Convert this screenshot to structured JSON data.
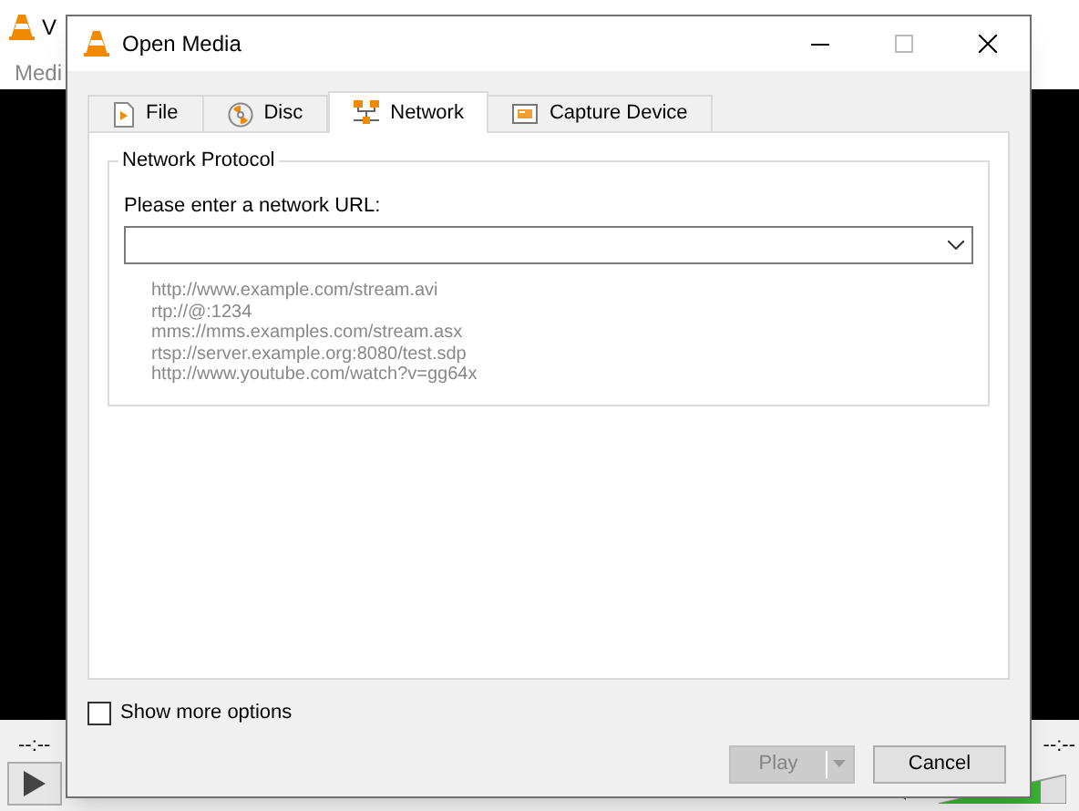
{
  "main_window": {
    "title": "V",
    "menu": [
      "Medi"
    ],
    "elapsed_time": "--:--",
    "total_time": "--:--",
    "volume": {
      "level": 0.8
    }
  },
  "dialog": {
    "title": "Open Media",
    "tabs": [
      {
        "label": "File",
        "kind": "file",
        "selected": false
      },
      {
        "label": "Disc",
        "kind": "disc",
        "selected": false
      },
      {
        "label": "Network",
        "kind": "network",
        "selected": true
      },
      {
        "label": "Capture Device",
        "kind": "capture",
        "selected": false
      }
    ],
    "group": {
      "title": "Network Protocol",
      "prompt": "Please enter a network URL:",
      "examples": [
        "http://www.example.com/stream.avi",
        "rtp://@:1234",
        "mms://mms.examples.com/stream.asx",
        "rtsp://server.example.org:8080/test.sdp",
        "http://www.youtube.com/watch?v=gg64x"
      ]
    },
    "show_more_options": {
      "label": "Show more options",
      "checked": false
    },
    "buttons": [
      {
        "label": "Play",
        "kind": "split",
        "disabled": true
      },
      {
        "label": "Cancel",
        "kind": "plain",
        "disabled": false
      }
    ]
  }
}
